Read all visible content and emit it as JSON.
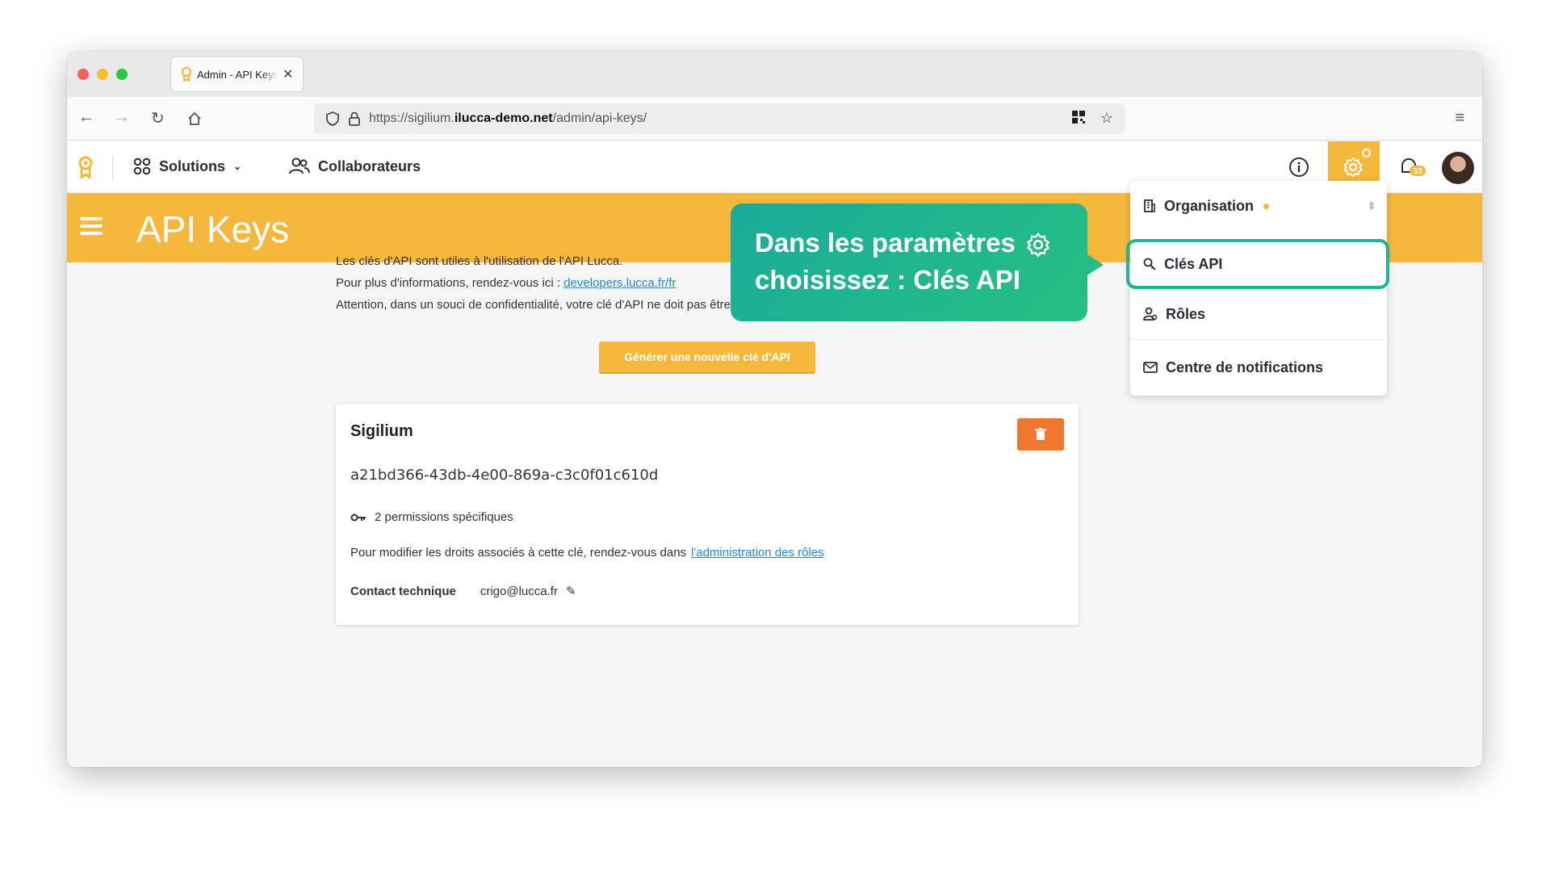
{
  "browser": {
    "tab_title": "Admin - API Keys",
    "url_prefix": "https://sigilium.",
    "url_domain": "ilucca-demo.net",
    "url_path": "/admin/api-keys/"
  },
  "header": {
    "solutions_label": "Solutions",
    "collaborators_label": "Collaborateurs",
    "notification_count": "33"
  },
  "banner": {
    "title": "API Keys"
  },
  "intro": {
    "line1": "Les clés d'API sont utiles à l'utilisation de l'API Lucca.",
    "line2_prefix": "Pour plus d'informations, rendez-vous ici :",
    "line2_link": "developers.lucca.fr/fr",
    "line3": "Attention, dans un souci de confidentialité, votre clé d'API ne doit pas être divulguée à n'importe qui."
  },
  "generate_button": "Générer une nouvelle clé d'API",
  "card": {
    "title": "Sigilium",
    "key": "a21bd366-43db-4e00-869a-c3c0f01c610d",
    "permissions": "2 permissions spécifiques",
    "roles_text": "Pour modifier les droits associés à cette clé, rendez-vous dans",
    "roles_link": "l'administration des rôles",
    "contact_label": "Contact technique",
    "contact_value": "crigo@lucca.fr"
  },
  "dropdown": {
    "items": [
      {
        "label": "Organisation"
      },
      {
        "label": "Clés API"
      },
      {
        "label": "Rôles"
      },
      {
        "label": "Centre de notifications"
      }
    ]
  },
  "callout": {
    "line1": "Dans les paramètres",
    "line2": "choisissez : Clés API"
  },
  "colors": {
    "brand": "#f5b83d",
    "callout": "#1db597",
    "delete": "#f0772f",
    "link": "#1e88e5"
  }
}
